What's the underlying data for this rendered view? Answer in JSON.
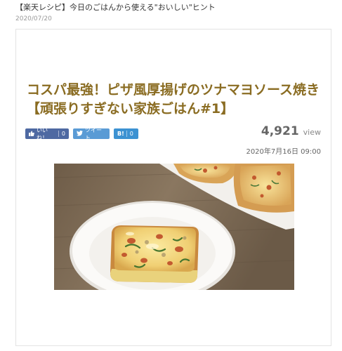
{
  "header": {
    "title": "【楽天レシピ】今日のごはんから使える\"おいしい\"ヒント",
    "date": "2020/07/20"
  },
  "article": {
    "title_line1": "コスパ最強！ピザ風厚揚げのツナマヨソース焼き",
    "title_line2": "【頑張りすぎない家族ごはん#1】",
    "views": "4,921",
    "views_label": "view",
    "published": "2020年7月16日 09:00"
  },
  "share": {
    "facebook_label": "いいね！",
    "facebook_count": "0",
    "twitter_label": "ツイート",
    "hatena_label": "B!",
    "hatena_count": "0"
  },
  "colors": {
    "title": "#8a6c22",
    "facebook": "#4e69a2",
    "twitter": "#5a9bd5",
    "hatena": "#3c92d2"
  },
  "icons": [
    "thumbs-up-icon",
    "bird-icon"
  ]
}
